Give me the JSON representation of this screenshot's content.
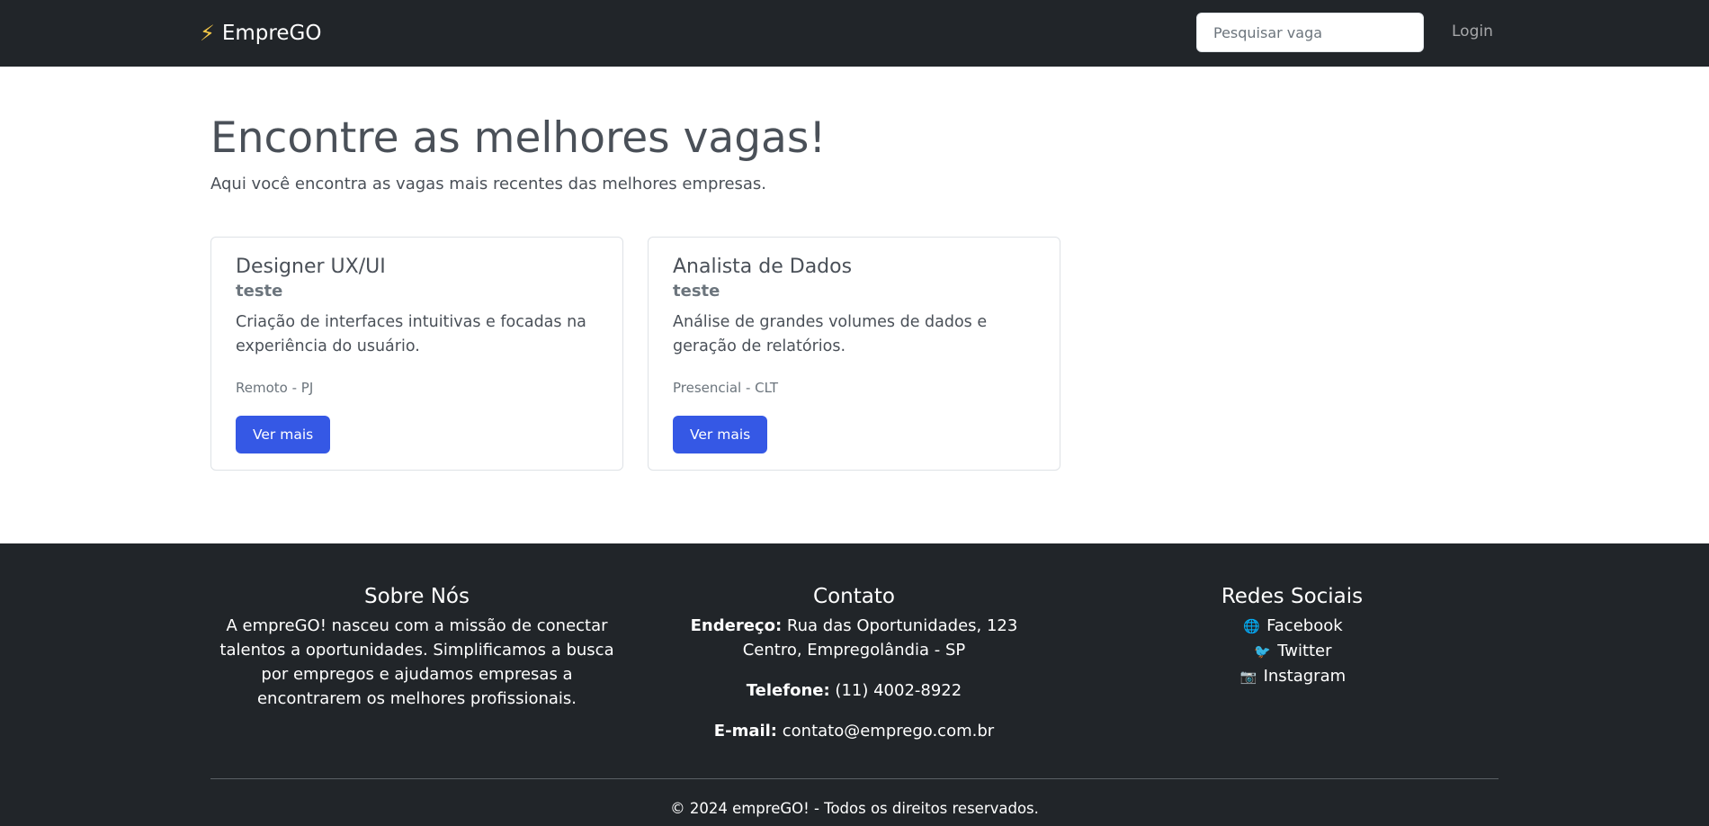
{
  "navbar": {
    "brand_icon": "⚡",
    "brand_name": "EmpreGO",
    "search_placeholder": "Pesquisar vaga",
    "login_label": "Login"
  },
  "hero": {
    "title": "Encontre as melhores vagas!",
    "subtitle": "Aqui você encontra as vagas mais recentes das melhores empresas."
  },
  "jobs": [
    {
      "title": "Designer UX/UI",
      "company": "teste",
      "description": "Criação de interfaces intuitivas e focadas na experiência do usuário.",
      "meta": "Remoto - PJ",
      "button_label": "Ver mais"
    },
    {
      "title": "Analista de Dados",
      "company": "teste",
      "description": "Análise de grandes volumes de dados e geração de relatórios.",
      "meta": "Presencial - CLT",
      "button_label": "Ver mais"
    }
  ],
  "footer": {
    "about": {
      "heading": "Sobre Nós",
      "text": "A empreGO! nasceu com a missão de conectar talentos a oportunidades. Simplificamos a busca por empregos e ajudamos empresas a encontrarem os melhores profissionais."
    },
    "contact": {
      "heading": "Contato",
      "address_label": "Endereço:",
      "address_line1": "Rua das Oportunidades, 123",
      "address_line2": "Centro, Empregolândia - SP",
      "phone_label": "Telefone:",
      "phone": "(11) 4002-8922",
      "email_label": "E-mail:",
      "email": "contato@emprego.com.br"
    },
    "social": {
      "heading": "Redes Sociais",
      "links": [
        {
          "icon": "🌐",
          "icon_name": "globe-icon",
          "label": "Facebook"
        },
        {
          "icon": "🐦",
          "icon_name": "bird-icon",
          "label": "Twitter"
        },
        {
          "icon": "📷",
          "icon_name": "camera-icon",
          "label": "Instagram"
        }
      ]
    },
    "copyright": "© 2024 empreGO! - Todos os direitos reservados."
  },
  "colors": {
    "navbar_bg": "#212529",
    "primary_button": "#3558e5",
    "text_muted": "#6c757d"
  }
}
